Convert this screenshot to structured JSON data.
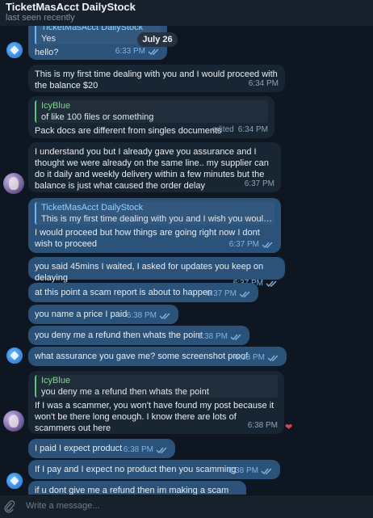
{
  "header": {
    "title": "TicketMasAcct DailyStock",
    "status": "last seen recently"
  },
  "date_badge": "July 26",
  "messages": [
    {
      "reply_name": "TicketMasAcct DailyStock",
      "reply_text": "Yes",
      "text": "hello?",
      "time": "6:33 PM"
    },
    {
      "text": "This is my first time dealing with you and I would proceed with the balance $20",
      "time": "6:34 PM"
    },
    {
      "reply_name": "IcyBlue",
      "reply_text": "of like 100 files or something",
      "text": "Pack docs are different from singles documents",
      "edited": "edited",
      "time": "6:34 PM"
    },
    {
      "text": "I understand you but I already gave you assurance and I thought we were already on the same line.. my supplier can do it daily and weekly delivery within a few minutes but the balance is just what caused the order delay",
      "time": "6:37 PM"
    },
    {
      "reply_name": "TicketMasAcct DailyStock",
      "reply_text": "This is my first time dealing with you and I wish you would pr...",
      "text": "I would proceed but how things are going right now I dont wish to proceed",
      "time": "6:37 PM"
    },
    {
      "text": "you said 45mins I waited, I asked for updates you keep on delaying",
      "time": "6:37 PM"
    },
    {
      "text": "at this point a scam report is about to happen",
      "time": "6:37 PM"
    },
    {
      "text": "you name a price I paid",
      "time": "6:38 PM"
    },
    {
      "text": "you deny me a refund then whats the point",
      "time": "6:38 PM"
    },
    {
      "text": "what assurance you gave me? some screenshot proof",
      "time": "6:38 PM"
    },
    {
      "reply_name": "IcyBlue",
      "reply_text": "you deny me a refund then whats the point",
      "text": "If I was a scammer, you won't have found my post because it won't be there long enough. I know there are lots of scammers out here",
      "time": "6:38 PM",
      "reaction": "❤"
    },
    {
      "text": "I paid I expect product",
      "time": "6:38 PM"
    },
    {
      "text": "If I pay and I expect no product then you scamming",
      "time": "6:38 PM"
    },
    {
      "text": "if u dont give me a refund then im making a scam report"
    }
  ],
  "composer": {
    "placeholder": "Write a message..."
  },
  "colors": {
    "background": "#0e1621",
    "incoming_bubble": "#182533",
    "outgoing_bubble": "#2b5278",
    "accent": "#6ab2f2"
  }
}
